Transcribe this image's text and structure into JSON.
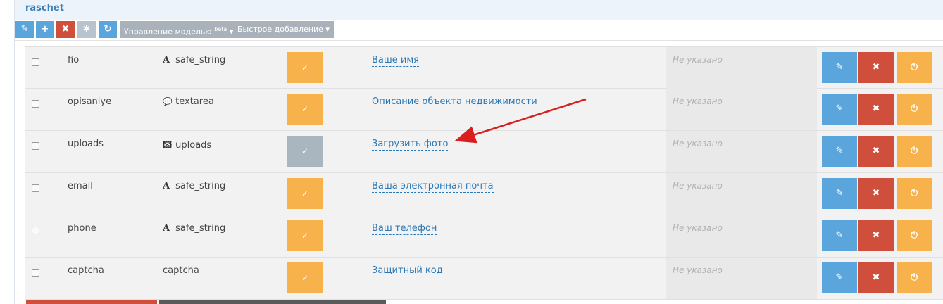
{
  "header": {
    "title": "raschet"
  },
  "toolbar": {
    "edit_icon": "✎",
    "add_icon": "+",
    "delete_icon": "✖",
    "star_icon": "✱",
    "refresh_icon": "↻",
    "model_menu_label": "Управление моделью",
    "model_menu_badge": "beta",
    "quick_add_label": "Быстрое добавление",
    "caret": "▾"
  },
  "rows": [
    {
      "name": "fio",
      "type_icon": "A",
      "type": "safe_string",
      "status_icon": "✓",
      "caption": "Ваше имя",
      "default": "Не указано"
    },
    {
      "name": "opisaniye",
      "type_icon": "💬",
      "type": "textarea",
      "status_icon": "✓",
      "caption": "Описание объекта недвижимости",
      "default": "Не указано"
    },
    {
      "name": "uploads",
      "type_icon": "🖾",
      "type": "uploads",
      "status_icon": "✓",
      "caption": "Загрузить фото",
      "default": "Не указано"
    },
    {
      "name": "email",
      "type_icon": "A",
      "type": "safe_string",
      "status_icon": "✓",
      "caption": "Ваша электронная почта",
      "default": "Не указано"
    },
    {
      "name": "phone",
      "type_icon": "A",
      "type": "safe_string",
      "status_icon": "✓",
      "caption": "Ваш телефон",
      "default": "Не указано"
    },
    {
      "name": "captcha",
      "type_icon": "",
      "type": "captcha",
      "status_icon": "✓",
      "caption": "Защитный код",
      "default": "Не указано"
    }
  ],
  "row_actions": {
    "edit_icon": "✎",
    "delete_icon": "✖",
    "power_icon": "⏻"
  },
  "colors": {
    "blue": "#5aa5dc",
    "red": "#cf4f3c",
    "orange": "#f8b24c",
    "gray": "#aab6bf",
    "link": "#2a78b7",
    "arrow": "#d81e1e"
  }
}
